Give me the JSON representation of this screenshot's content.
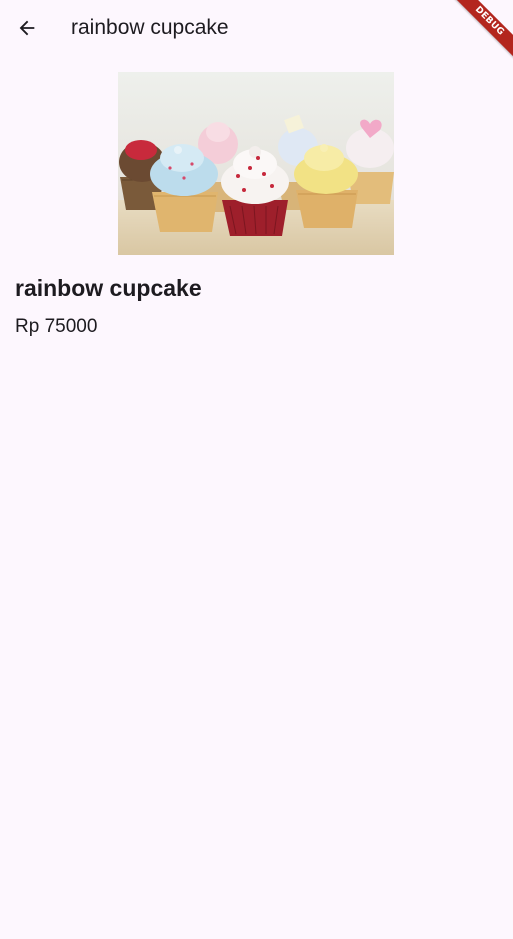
{
  "appbar": {
    "title": "rainbow cupcake",
    "back_icon": "arrow-back-icon"
  },
  "debug_banner": {
    "label": "DEBUG",
    "color": "#b3261e"
  },
  "product": {
    "image_alt": "cupcakes photo",
    "name": "rainbow cupcake",
    "price": "Rp 75000"
  },
  "colors": {
    "background": "#fdf7fe",
    "text": "#1d1b20"
  }
}
